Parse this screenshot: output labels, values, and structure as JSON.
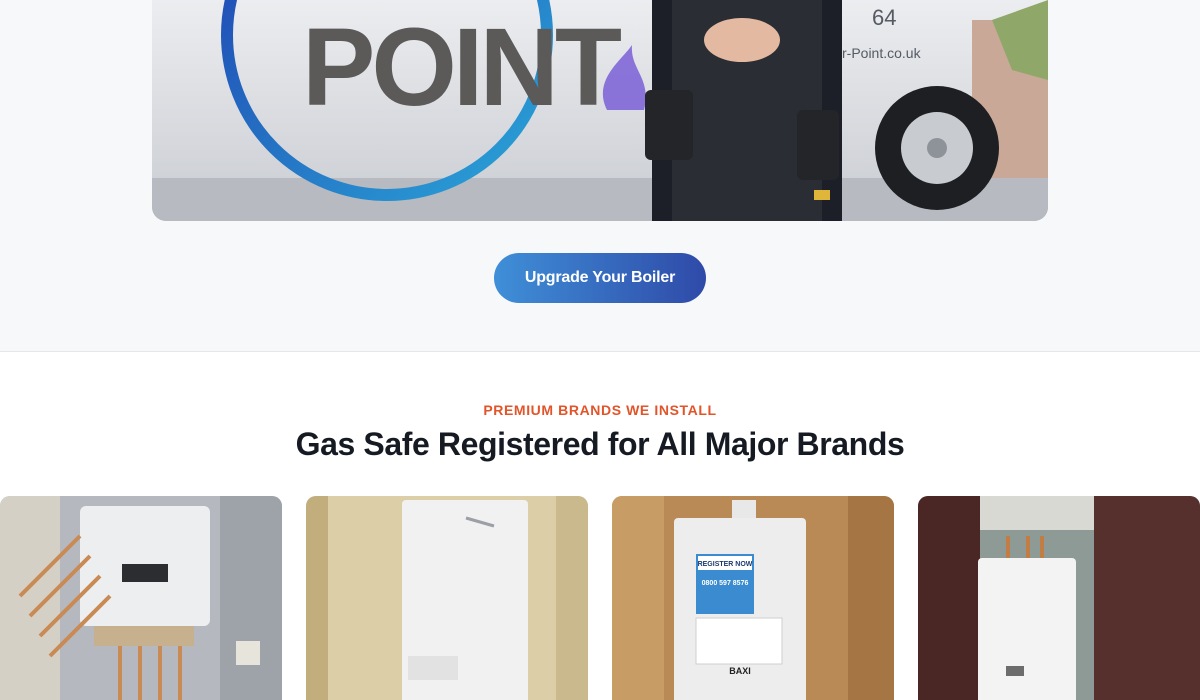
{
  "hero": {
    "van_logo_text": "POINT",
    "van_phone_fragment": "64",
    "van_web_fragment": "r-Point.co.uk",
    "cta_label": "Upgrade Your Boiler"
  },
  "brands": {
    "eyebrow": "PREMIUM BRANDS WE INSTALL",
    "title": "Gas Safe Registered for All Major Brands",
    "cards": [
      {
        "subject": "vaillant-boiler"
      },
      {
        "subject": "worcester-boiler"
      },
      {
        "subject": "baxi-boiler",
        "sticker_lines": [
          "REGISTER NOW",
          "0800 597 8576"
        ],
        "badge": "BAXI"
      },
      {
        "subject": "ideal-boiler"
      }
    ]
  },
  "colors": {
    "accent_orange": "#e2542a",
    "cta_start": "#3f8fd8",
    "cta_end": "#2f4aa8",
    "heading": "#161a22"
  }
}
